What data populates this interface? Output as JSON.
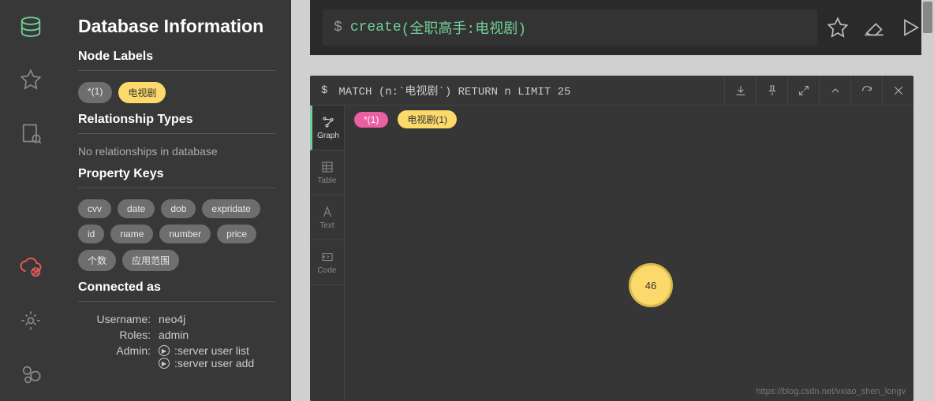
{
  "sidebar": {
    "title": "Database Information",
    "sections": {
      "nodeLabels": {
        "heading": "Node Labels",
        "items": [
          "*(1)",
          "电视剧"
        ]
      },
      "relTypes": {
        "heading": "Relationship Types",
        "empty": "No relationships in database"
      },
      "propKeys": {
        "heading": "Property Keys",
        "items": [
          "cvv",
          "date",
          "dob",
          "expridate",
          "id",
          "name",
          "number",
          "price",
          "个数",
          "应用范围"
        ]
      },
      "connected": {
        "heading": "Connected as",
        "username_label": "Username:",
        "username": "neo4j",
        "roles_label": "Roles:",
        "roles": "admin",
        "admin_label": "Admin:",
        "admin_cmds": [
          ":server user list",
          ":server user add"
        ]
      }
    }
  },
  "editor": {
    "prompt": "$",
    "command_kw": "create",
    "command_args": "(全职高手:电视剧)"
  },
  "result": {
    "prompt": "$",
    "query": "MATCH (n:`电视剧`) RETURN n LIMIT 25",
    "tabs": [
      "Graph",
      "Table",
      "Text",
      "Code"
    ],
    "badges": {
      "star": "*(1)",
      "label_name": "电视剧",
      "label_count": "(1)"
    },
    "node_value": "46"
  },
  "watermark": "https://blog.csdn.net/vxiao_shen_longv"
}
